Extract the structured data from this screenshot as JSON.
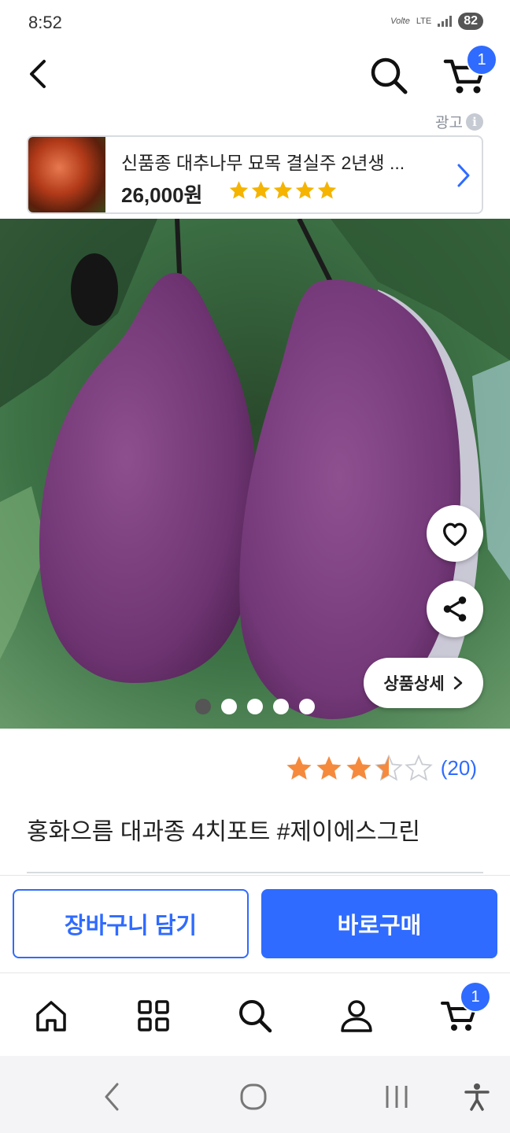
{
  "status_bar": {
    "time": "8:52",
    "volte": "Volte",
    "network": "LTE",
    "battery": "82"
  },
  "header": {
    "back_icon": "chevron-left-icon",
    "search_icon": "search-icon",
    "cart_icon": "cart-icon",
    "cart_badge": "1"
  },
  "ad": {
    "label": "광고",
    "info_icon": "i",
    "title": "신품종 대추나무 묘목 결실주 2년생 ...",
    "price": "26,000원",
    "rating_stars": 5,
    "star_color": "#f5b400"
  },
  "gallery": {
    "image_description_icon": "product-photo",
    "current_index": 0,
    "total": 5,
    "wish_icon": "heart-icon",
    "share_icon": "share-icon",
    "detail_label": "상품상세"
  },
  "product": {
    "rating_value": 3.5,
    "rating_count": "(20)",
    "title": "홍화으름 대과종 4치포트 #제이에스그린"
  },
  "actions": {
    "add_to_cart": "장바구니 담기",
    "buy_now": "바로구매"
  },
  "bottom_nav": {
    "items": [
      "home-icon",
      "category-icon",
      "search-icon",
      "profile-icon",
      "cart-icon"
    ],
    "cart_badge": "1"
  },
  "system_nav": {
    "items": [
      "back-icon",
      "home-icon",
      "recents-icon",
      "accessibility-icon"
    ]
  },
  "colors": {
    "accent": "#2f6bff",
    "star_orange": "#f58a3d"
  }
}
